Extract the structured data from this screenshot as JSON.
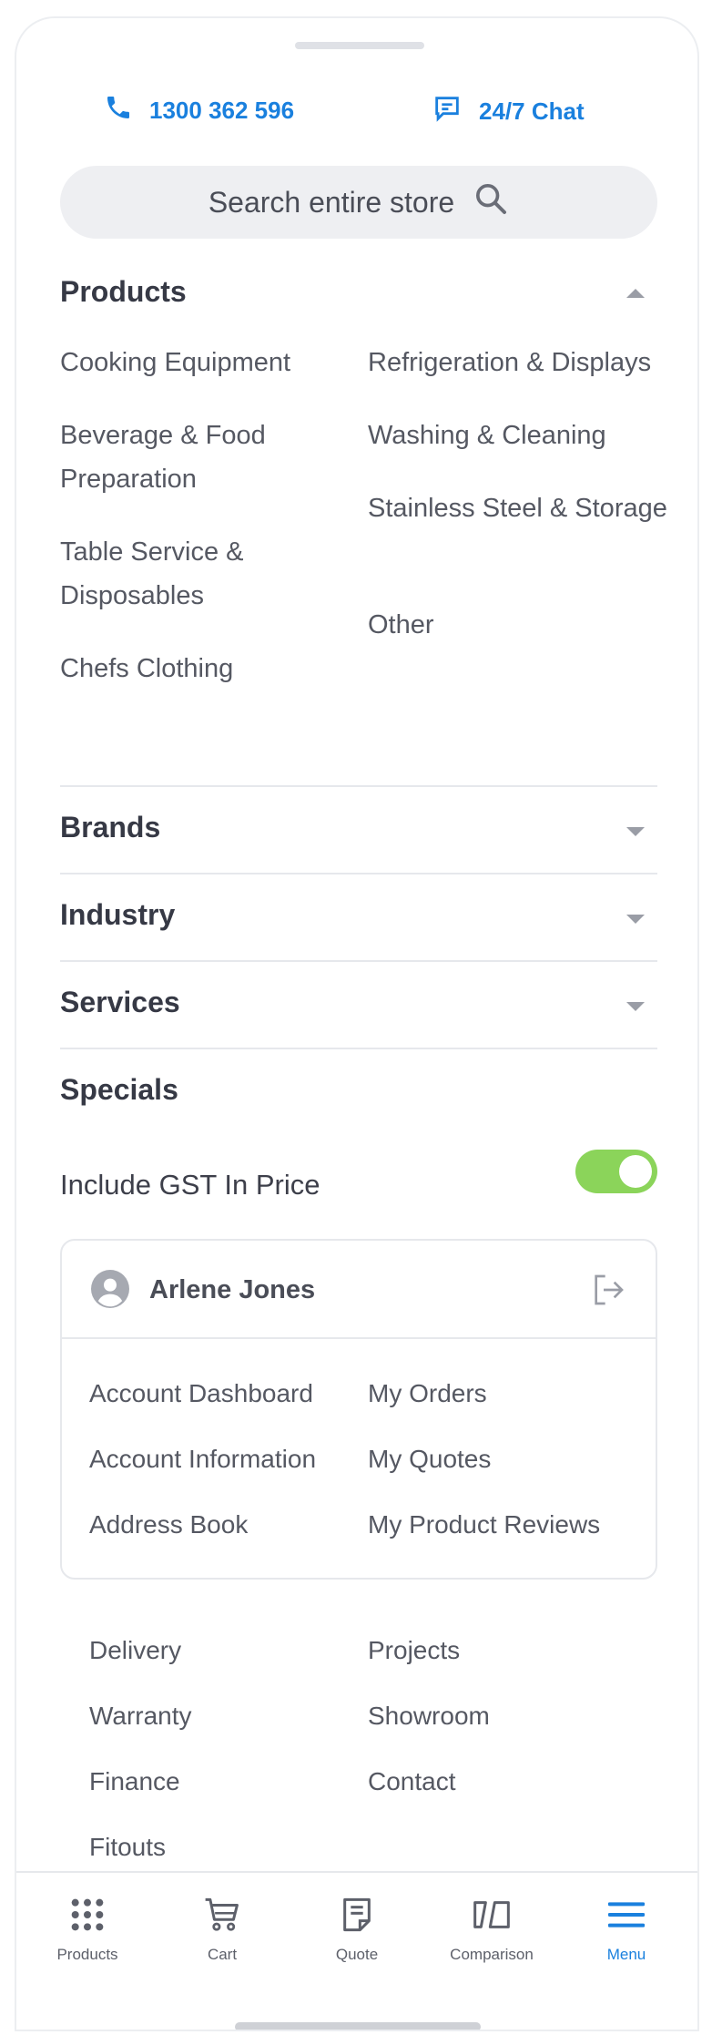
{
  "contact": {
    "phone": "1300 362 596",
    "chat": "24/7 Chat"
  },
  "search": {
    "placeholder": "Search entire store"
  },
  "products": {
    "title": "Products",
    "col1": [
      "Cooking Equipment",
      "Beverage & Food Preparation",
      "Table Service & Disposables",
      "Chefs Clothing"
    ],
    "col2": [
      "Refrigeration & Displays",
      "Washing & Cleaning",
      "Stainless Steel & Storage",
      "Other"
    ]
  },
  "sections": {
    "brands": "Brands",
    "industry": "Industry",
    "services": "Services",
    "specials": "Specials"
  },
  "gst": {
    "label": "Include GST In Price",
    "enabled": true
  },
  "account": {
    "name": "Arlene Jones",
    "links_col1": [
      "Account Dashboard",
      "Account Information",
      "Address Book"
    ],
    "links_col2": [
      "My Orders",
      "My Quotes",
      "My Product Reviews"
    ]
  },
  "footer_links": {
    "col1": [
      "Delivery",
      "Warranty",
      "Finance",
      "Fitouts"
    ],
    "col2": [
      "Projects",
      "Showroom",
      "Contact"
    ]
  },
  "tabbar": {
    "items": [
      {
        "label": "Products",
        "icon": "grid-icon"
      },
      {
        "label": "Cart",
        "icon": "cart-icon"
      },
      {
        "label": "Quote",
        "icon": "quote-icon"
      },
      {
        "label": "Comparison",
        "icon": "compare-icon"
      },
      {
        "label": "Menu",
        "icon": "menu-icon"
      }
    ],
    "active": "Menu"
  },
  "colors": {
    "accent": "#1a80de",
    "toggle_on": "#8bd45a",
    "text": "#3d3f4a"
  }
}
